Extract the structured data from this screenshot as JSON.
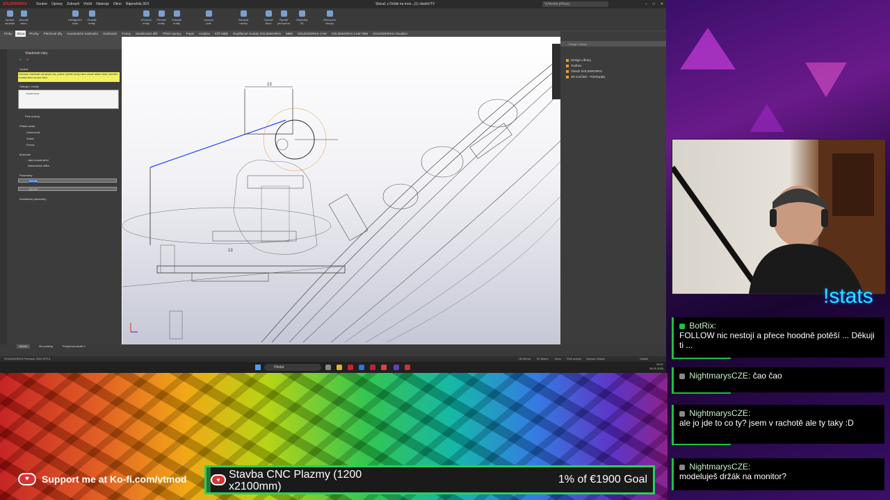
{
  "solidworks": {
    "logo": "SOLIDWORKS",
    "menus": [
      "Soubor",
      "Úpravy",
      "Zobrazit",
      "Vložit",
      "Nástroje",
      "Okno",
      "Nápověda 3DX"
    ],
    "document_title": "Skica1 z Držák na mon...(1) vlastní/TV",
    "search_placeholder": "Vyhledat příkazy",
    "ribbon_buttons": [
      "Upravit součást",
      "Ukončit skicu",
      "Inteligentní kóta",
      "Zrcadlit entity",
      "Oříznout entity",
      "Převést entity",
      "Odsadit entity",
      "Lineární pole",
      "Zobrazit vztahy",
      "Opravit skicu",
      "Rychlé přichycení",
      "Okamžitý 2D",
      "Stínované obrysy"
    ],
    "tabs": [
      "Prvky",
      "Skica",
      "Plochy",
      "Plechové díly",
      "Konstrukční svařování",
      "Svařování",
      "Formy",
      "Modelování dílů",
      "Přímé úpravy",
      "Popis",
      "Analýza",
      "Kříž MBD",
      "Doplňkové moduly SOLIDWORKS",
      "MBD",
      "SOLIDWORKS CAM",
      "SOLIDWORKS CAM TBM",
      "SOLIDWORKS Visualize"
    ],
    "active_tab": "Skica",
    "property_manager": {
      "title": "Vlastnosti čáry",
      "section_message": "Zpráva",
      "message": "Zobrazte vlastnosti vybraných čar, pokud vyberte prvky mimo dosah aktivní skici, otevřete rozklad skici na více částí.",
      "section_existing": "Stávající vztahy",
      "existing_item": "Vodorovná",
      "info": "Plně určený",
      "section_add": "Přidat vazby",
      "add_items": [
        "Vodorovná",
        "Svislá",
        "Pevná"
      ],
      "section_options": "Možnosti",
      "options": [
        "Jako konstrukční",
        "Nekonečná délka"
      ],
      "section_params": "Parametry",
      "param_value": "139.00",
      "param_angle": "180.00°",
      "section_additional": "Dodatečné parametry"
    },
    "dimension_top": "13",
    "dimension_mid": "13",
    "task_pane": {
      "search": "Design Library",
      "items": [
        "Design Library",
        "Toolbox",
        "Obsah SOLIDWORKS",
        "3D součásti - PartSupply"
      ]
    },
    "bottom_tabs": [
      "Model",
      "3D pohledy",
      "Pohybová studie 1"
    ],
    "status_left": "SOLIDWORKS Premium 2024 SP3.0",
    "status_right": [
      "-35.00mm",
      "51.35mm",
      "0mm",
      "Plně určený",
      "Úprava: Skica1",
      "Vlastní"
    ],
    "taskbar_search": "Hledat",
    "clock_time": "20:07",
    "clock_date": "26.01.2026"
  },
  "stream": {
    "stats_label": "!stats",
    "chat": [
      {
        "author": "BotRix:",
        "text": "FOLLOW nic nestojí a přece hoodně potěší ... Děkuji ti ...",
        "badge_color": "#20c040"
      },
      {
        "author": "NightmarysCZE:",
        "text": "čao čao",
        "badge_color": "#888888"
      },
      {
        "author": "NightmarysCZE:",
        "text": "ale jo jde to co ty? jsem v rachotě ale ty taky :D",
        "badge_color": "#888888"
      },
      {
        "author": "NightmarysCZE:",
        "text": "modeluješ držák na monitor?",
        "badge_color": "#888888"
      }
    ],
    "kofi_text": "Support me at Ko-fi.com/vtmod",
    "goal_title": "Stavba CNC Plazmy (1200 x2100mm)",
    "goal_amount": "1% of €1900 Goal",
    "goal_progress_percent": 1
  },
  "colors": {
    "chat_accent": "#20c040",
    "goal_border": "#2ad05a",
    "stats_color": "#20e8ff",
    "kofi_red": "#e03030"
  }
}
